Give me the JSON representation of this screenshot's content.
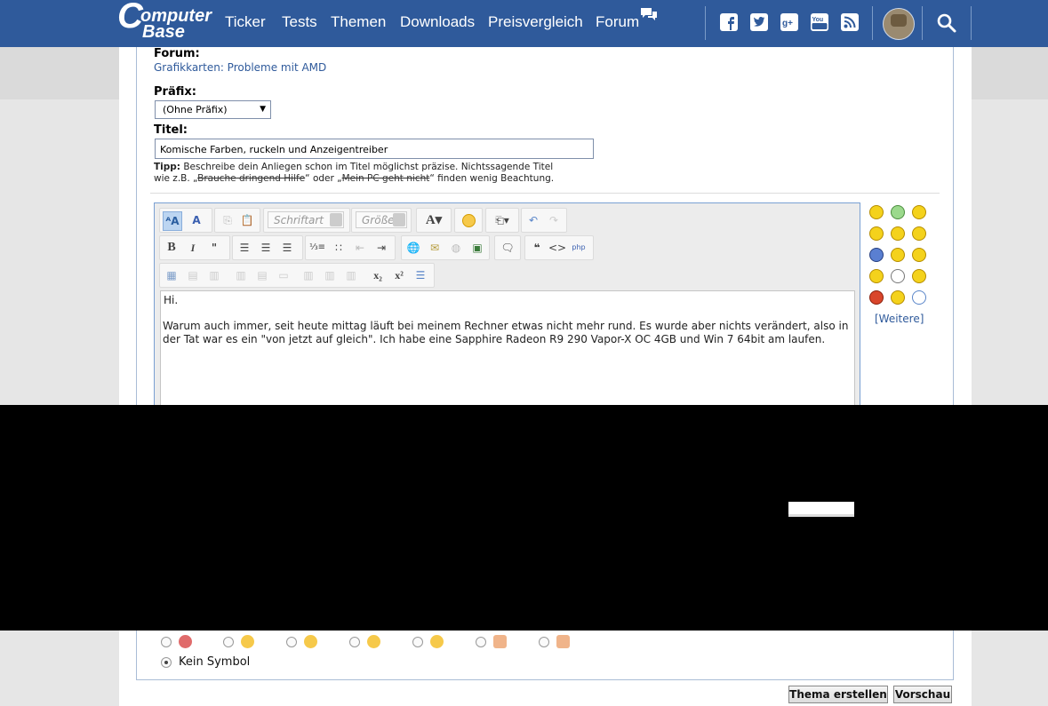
{
  "site": {
    "logo_line1": "omputer",
    "logo_line2": "Base",
    "logo_c": "C"
  },
  "nav": {
    "items": [
      {
        "label": "Ticker"
      },
      {
        "label": "Tests"
      },
      {
        "label": "Themen"
      },
      {
        "label": "Downloads"
      },
      {
        "label": "Preisvergleich"
      },
      {
        "label": "Forum"
      }
    ],
    "social_icons": [
      "facebook-icon",
      "twitter-icon",
      "google-plus-icon",
      "youtube-icon",
      "rss-icon"
    ],
    "brand_color": "#2f5a9b"
  },
  "form": {
    "forum_label": "Forum:",
    "forum_link": "Grafikkarten: Probleme mit AMD",
    "prefix_label": "Präfix:",
    "prefix_value": "(Ohne Präfix)",
    "title_label": "Titel:",
    "title_value": "Komische Farben, ruckeln und Anzeigentreiber",
    "tip_bold": "Tipp:",
    "tip_text1": " Beschreibe dein Anliegen schon im Titel möglichst präzise. Nichtssagende Titel",
    "tip_text2a": "wie z.B. „",
    "tip_strike1": "Brauche dringend Hilfe",
    "tip_text2b": "“ oder „",
    "tip_strike2": "Mein PC geht nicht",
    "tip_text2c": "“ finden wenig Beachtung."
  },
  "editor": {
    "font_combo": "Schriftart",
    "size_combo": "Größe",
    "body_line1": "Hi.",
    "body_para": "Warum auch immer, seit heute mittag läuft bei meinem Rechner etwas nicht mehr rund. Es wurde aber nichts verändert, also in der Tat war es ein \"von jetzt auf gleich\". Ich habe eine Sapphire Radeon R9 290 Vapor-X OC 4GB und Win 7 64bit am laufen."
  },
  "smilies": {
    "more_link": "[Weitere]"
  },
  "post_icon": {
    "none_label": "Kein Symbol"
  },
  "buttons": {
    "create": "Thema erstellen",
    "preview": "Vorschau"
  }
}
